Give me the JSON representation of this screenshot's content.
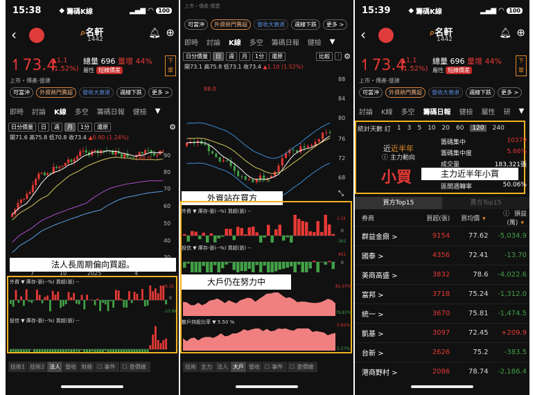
{
  "colors": {
    "up": "#e53935",
    "down": "#43a047",
    "highlight": "#f3b321",
    "bg": "#111111"
  },
  "panel1": {
    "time": "15:38",
    "app_name": "籌碼K線",
    "battery": "100",
    "stock_name": "名軒",
    "stock_code": "1442",
    "price": "73.4",
    "change": "▲1.1",
    "change_pct": "(1.52%)",
    "volume": "總量 696",
    "volume_ratio": "量增 44%",
    "attr_label": "屬性",
    "attr_tag": "短線價差",
    "order_label": "下單",
    "market": "上市・傳產-營建",
    "chips": [
      "可當沖",
      "外資熱門賣超",
      "營收大衰退",
      "週線下跌",
      "更多 >"
    ],
    "tabs": [
      "即時",
      "討論",
      "K線",
      "多空",
      "籌碼日報",
      "健檢"
    ],
    "toolbar": [
      "日分價量",
      "日",
      "週",
      "月",
      "1分",
      "還原"
    ],
    "ohlc": "開71.6 高75.8 低70.8 收73.4",
    "ohlc_chg": "▲0.90 (1.24%)",
    "ma_label": "88.0",
    "y_ticks": [
      "90",
      "80",
      "70",
      "60",
      "50",
      "40",
      "30"
    ],
    "x_ticks": [
      "7",
      "10",
      "2025",
      "4"
    ],
    "callout": "法人長周期偏向買超。",
    "sub1_head": "外資 ▼ 庫存-張(--%) 買超(張) --",
    "sub1_y": [
      "6.1k",
      "0",
      "-10.8k"
    ],
    "sub2_head": "投信 ▼ 庫存-張(--%) 買超(張) --",
    "bottom_tabs": [
      "技術1",
      "技術2",
      "法人",
      "營收",
      "財務",
      "事件",
      "查價線"
    ]
  },
  "panel2": {
    "top_frag": "上市・傳產-營建",
    "chips": [
      "可當沖",
      "外資熱門賣超",
      "營收大衰退",
      "週線下跌",
      "更多 >"
    ],
    "tabs": [
      "即時",
      "討論",
      "K線",
      "多空",
      "籌碼日報",
      "健檢"
    ],
    "toolbar": [
      "日分價量",
      "日",
      "週",
      "月",
      "1分",
      "還原",
      "比較"
    ],
    "ohlc": "開73.1 高75.8 低73.1 收73.4",
    "ohlc_chg": "▲1.10 (1.52%)",
    "ma_label": "88.0",
    "low_label": "67.3",
    "y_ticks": [
      "88",
      "84",
      "80",
      "76",
      "72",
      "68"
    ],
    "callout_top": "外資站在買方",
    "callout_bottom": "大戶仍在努力中",
    "sub1_head": "外資 ▼ 庫存-張(--%) 買超(張) --",
    "sub1_y": [
      "1.1k",
      "0",
      "-361"
    ],
    "sub2_head": "投信 ▼ 庫存-張(--%) 買超(張) --",
    "sub2_y": [
      "451",
      "0"
    ],
    "sub3_y": [
      "81.07%",
      "79.87%"
    ],
    "sub4_head": "散戶持股比率 ▼ 5.50 %",
    "sub4_y": [
      "5.92%",
      "5.27%"
    ],
    "bottom_tabs": [
      "技術",
      "主力",
      "法人",
      "大戶",
      "營收",
      "事件",
      "查價線"
    ]
  },
  "panel3": {
    "time": "15:39",
    "app_name": "籌碼K線",
    "battery": "100",
    "stock_name": "名軒",
    "stock_code": "1442",
    "price": "73.4",
    "change": "▲1.1",
    "change_pct": "(1.52%)",
    "volume": "總量 696",
    "volume_ratio": "量增 44%",
    "attr_label": "屬性",
    "attr_tag": "短線價差",
    "order_label": "下單",
    "market": "上市・傳產-營建",
    "chips": [
      "可當沖",
      "外資熱門賣超",
      "營收大衰退",
      "週線下跌",
      "更多 >"
    ],
    "tabs": [
      "討論",
      "K線",
      "多空",
      "籌碼日報",
      "健檢",
      "屬性",
      "研"
    ],
    "days_label": "統計天數 訂",
    "days": [
      "1",
      "3",
      "5",
      "10",
      "20",
      "60",
      "120",
      "240"
    ],
    "summary_title": "近半年",
    "summary_sub": "主力動向",
    "big_label": "小買",
    "callout": "主力近半年小買",
    "stats": [
      {
        "label": "籌碼集中",
        "value": "10379"
      },
      {
        "label": "籌碼集中度",
        "value": "5.66%"
      },
      {
        "label": "成交量",
        "value": "183,321張"
      },
      {
        "label": "區間週轉率",
        "value": "50.06%"
      }
    ],
    "toggle": [
      "買方Top15",
      "賣方Top15"
    ],
    "columns": [
      "券商",
      "買超(張)",
      "買均價",
      "損益(萬)"
    ],
    "rows": [
      {
        "name": "群益金鼎 >",
        "qty": "9154",
        "avg": "77.62",
        "pl": "-5,034.9"
      },
      {
        "name": "國泰 >",
        "qty": "4356",
        "avg": "72.41",
        "pl": "-13.70"
      },
      {
        "name": "美商高盛 >",
        "qty": "3832",
        "avg": "78.6",
        "pl": "-4,022.6"
      },
      {
        "name": "富邦 >",
        "qty": "3718",
        "avg": "75.24",
        "pl": "-1,312.0"
      },
      {
        "name": "統一 >",
        "qty": "3670",
        "avg": "75.81",
        "pl": "-1,474.5"
      },
      {
        "name": "凱基 >",
        "qty": "3097",
        "avg": "72.45",
        "pl": "+209.9"
      },
      {
        "name": "台新 >",
        "qty": "2626",
        "avg": "75.2",
        "pl": "-383.5"
      },
      {
        "name": "港商野村 >",
        "qty": "2086",
        "avg": "78.74",
        "pl": "-2,186.4"
      }
    ]
  }
}
